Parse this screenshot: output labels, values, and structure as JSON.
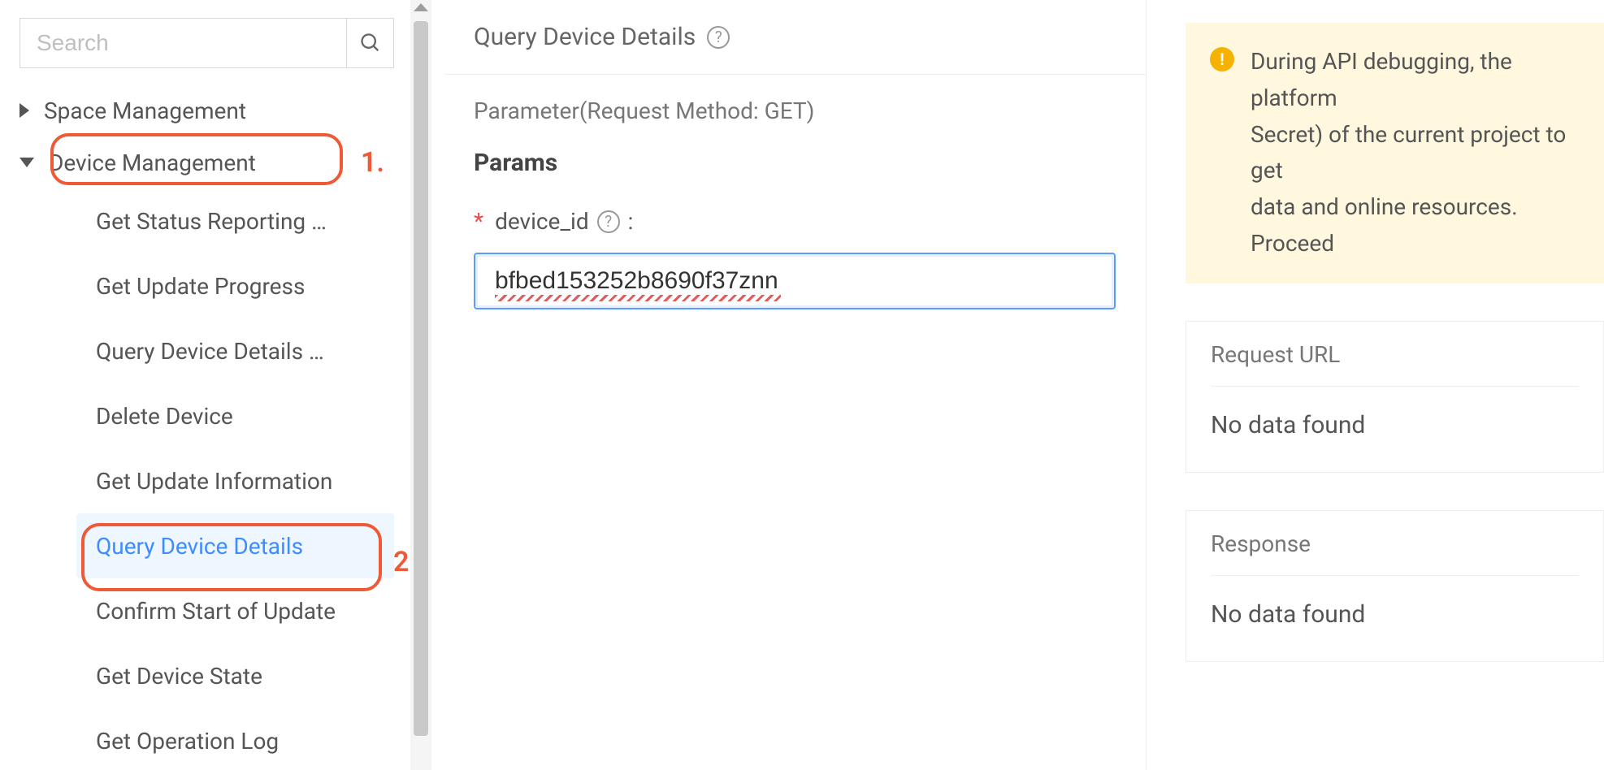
{
  "sidebar": {
    "search_placeholder": "Search",
    "nodes": [
      {
        "label": "Space Management",
        "expanded": false
      },
      {
        "label": "Device Management",
        "expanded": true
      }
    ],
    "device_children": [
      "Get Status Reporting …",
      "Get Update Progress",
      "Query Device Details …",
      "Delete Device",
      "Get Update Information",
      "Query Device Details",
      "Confirm Start of Update",
      "Get Device State",
      "Get Operation Log"
    ],
    "selected_index": 5
  },
  "annotations": {
    "one": "1.",
    "two": "2."
  },
  "main": {
    "title": "Query Device Details",
    "param_heading": "Parameter(Request Method: GET)",
    "params_label": "Params",
    "field_device_id": "device_id",
    "field_colon": ":",
    "device_id_value": "bfbed153252b8690f37znn"
  },
  "right": {
    "warning_lines": [
      "During API debugging, the platform",
      "Secret) of the current project to get",
      "data and online resources. Proceed"
    ],
    "request_url_title": "Request URL",
    "request_url_body": "No data found",
    "response_title": "Response",
    "response_body": "No data found"
  },
  "icons": {
    "help_glyph": "?",
    "warn_glyph": "!"
  }
}
